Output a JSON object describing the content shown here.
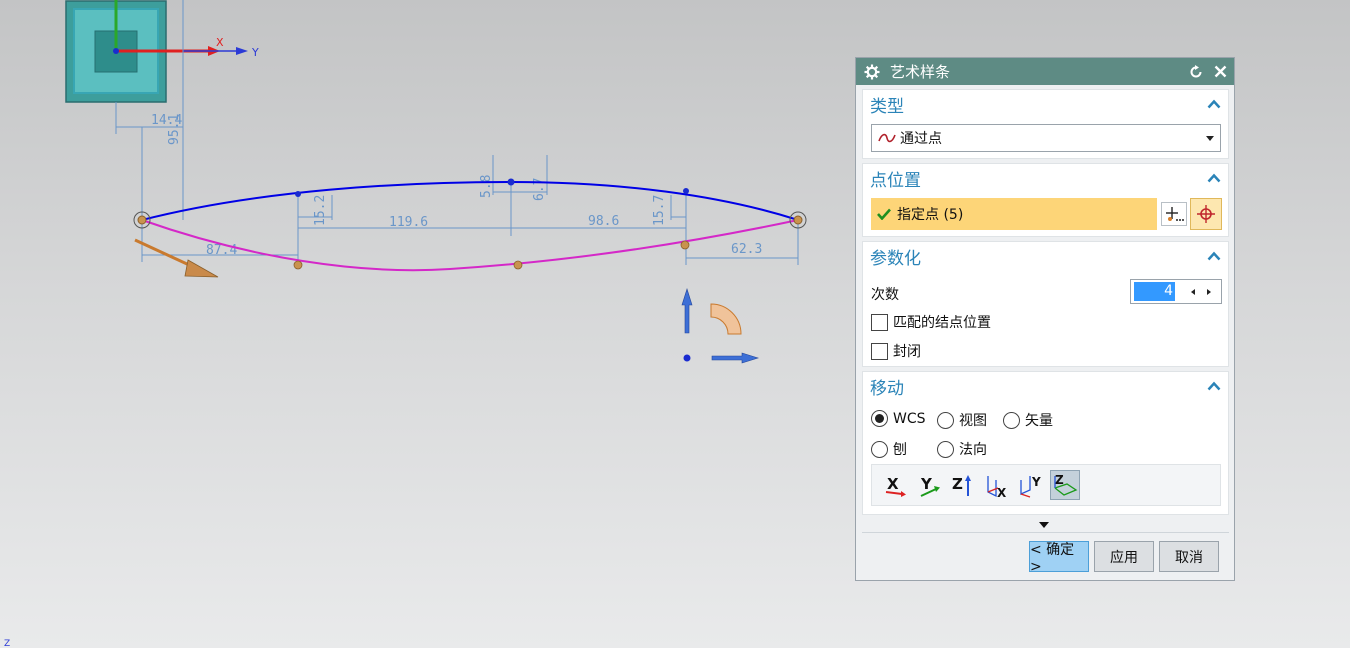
{
  "viewport": {
    "wcs_labels": {
      "x": "X",
      "y": "Y",
      "z": "Z"
    },
    "dimensions": [
      "14.4",
      "95.1",
      "5.8",
      "6.7",
      "15.2",
      "119.6",
      "98.6",
      "15.7",
      "87.4",
      "62.3"
    ]
  },
  "dialog": {
    "title": "艺术样条",
    "type_section": {
      "title": "类型",
      "selected": "通过点"
    },
    "point_section": {
      "title": "点位置",
      "specify_point": "指定点 (5)"
    },
    "param_section": {
      "title": "参数化",
      "degree_label": "次数",
      "degree_value": "4",
      "match_knots_label": "匹配的结点位置",
      "closed_label": "封闭"
    },
    "move_section": {
      "title": "移动",
      "options": [
        "WCS",
        "视图",
        "矢量",
        "刨",
        "法向"
      ],
      "selected": "WCS",
      "axis_buttons": [
        "X",
        "Y",
        "Z"
      ]
    },
    "buttons": {
      "ok": "< 确定 >",
      "apply": "应用",
      "cancel": "取消"
    }
  },
  "colors": {
    "title_bar": "#5e8b84",
    "section_header": "#2b84b8",
    "highlight": "#fdd578",
    "upper_curve": "#0000e6",
    "lower_curve": "#d428c8",
    "dimension": "#6a96c9",
    "ok_button": "#9fd1f4"
  }
}
